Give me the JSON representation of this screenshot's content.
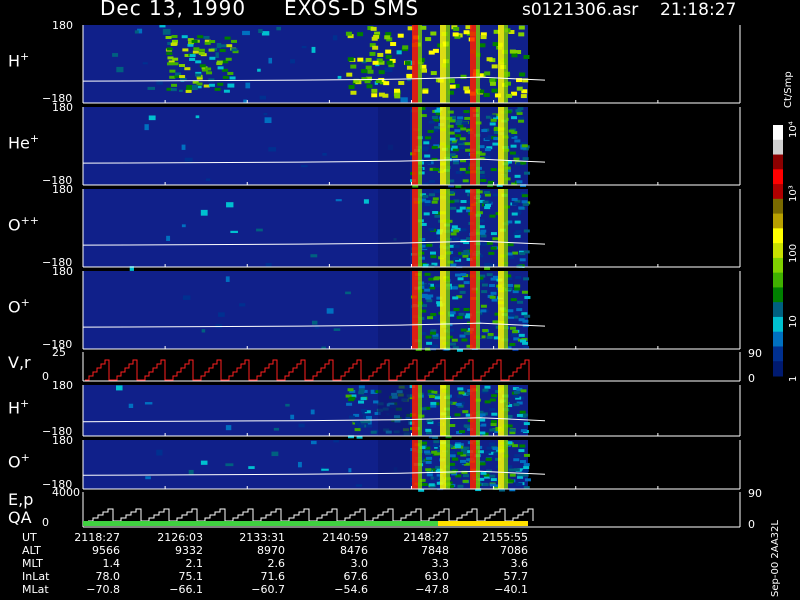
{
  "header": {
    "date": "Dec 13, 1990",
    "instrument": "EXOS-D SMS",
    "file": "s0121306.asr",
    "time": "21:18:27"
  },
  "panels": [
    {
      "id": "Hplus",
      "label": "H",
      "sup": "+",
      "ymax": "180",
      "ymin": "−180"
    },
    {
      "id": "Heplus",
      "label": "He",
      "sup": "+",
      "ymax": "180",
      "ymin": "−180"
    },
    {
      "id": "Oplusplus",
      "label": "O",
      "sup": "++",
      "ymax": "180",
      "ymin": "−180"
    },
    {
      "id": "Oplus",
      "label": "O",
      "sup": "+",
      "ymax": "180",
      "ymin": "−180"
    },
    {
      "id": "Vr",
      "label": "V,r",
      "sup": "",
      "ymax": "25",
      "ymin": "0",
      "right_top": "90",
      "right_bot": "0"
    },
    {
      "id": "Hplus2",
      "label": "H",
      "sup": "+",
      "ymax": "180",
      "ymin": "−180"
    },
    {
      "id": "Oplus2",
      "label": "O",
      "sup": "+",
      "ymax": "180",
      "ymin": "−180"
    },
    {
      "id": "Ep",
      "label": "E,p",
      "label2": "QA",
      "sup": "",
      "ymax": "4000",
      "ymin": "0",
      "right_top": "90",
      "right_bot": "0"
    }
  ],
  "colorbar": {
    "unit": "Ct/Smp",
    "ticks": [
      "10⁴",
      "10³",
      "100",
      "10",
      "1"
    ],
    "colors": [
      "#ffffff",
      "#d0d0d0",
      "#8b0000",
      "#ff0000",
      "#b00000",
      "#7a6a00",
      "#b8a000",
      "#ffff00",
      "#c8e000",
      "#80d000",
      "#40b000",
      "#008000",
      "#006080",
      "#00c0d0",
      "#0070c0",
      "#003090",
      "#001a70"
    ]
  },
  "footer_label": "Sep-00 2AA32L",
  "orbit_table": {
    "rows": [
      "UT",
      "ALT",
      "MLT",
      "InLat",
      "MLat"
    ],
    "columns": [
      [
        "2118:27",
        "9566",
        "1.4",
        "78.0",
        "−70.8"
      ],
      [
        "2126:03",
        "9332",
        "2.1",
        "75.1",
        "−66.1"
      ],
      [
        "2133:31",
        "8970",
        "2.6",
        "71.6",
        "−60.7"
      ],
      [
        "2140:59",
        "8476",
        "3.0",
        "67.6",
        "−54.6"
      ],
      [
        "2148:27",
        "7848",
        "3.3",
        "63.0",
        "−47.8"
      ],
      [
        "2155:55",
        "7086",
        "3.6",
        "57.7",
        "−40.1"
      ]
    ]
  },
  "chart_data": {
    "type": "heatmap",
    "title": "Dec 13, 1990  EXOS-D SMS",
    "xlabel": "UT",
    "x_ticks": [
      "2118:27",
      "2126:03",
      "2133:31",
      "2140:59",
      "2148:27",
      "2155:55"
    ],
    "panels": [
      {
        "species": "H+",
        "ylim": [
          -180,
          180
        ]
      },
      {
        "species": "He+",
        "ylim": [
          -180,
          180
        ]
      },
      {
        "species": "O++",
        "ylim": [
          -180,
          180
        ]
      },
      {
        "species": "O+",
        "ylim": [
          -180,
          180
        ]
      },
      {
        "species": "V,r",
        "ylim": [
          0,
          25
        ],
        "right_ylim": [
          0,
          90
        ]
      },
      {
        "species": "H+",
        "ylim": [
          -180,
          180
        ]
      },
      {
        "species": "O+",
        "ylim": [
          -180,
          180
        ]
      },
      {
        "species": "E,p / QA",
        "ylim": [
          0,
          4000
        ],
        "right_ylim": [
          0,
          90
        ]
      }
    ],
    "colorbar": {
      "label": "Ct/Smp",
      "scale": "log",
      "range": [
        1,
        10000
      ]
    }
  }
}
